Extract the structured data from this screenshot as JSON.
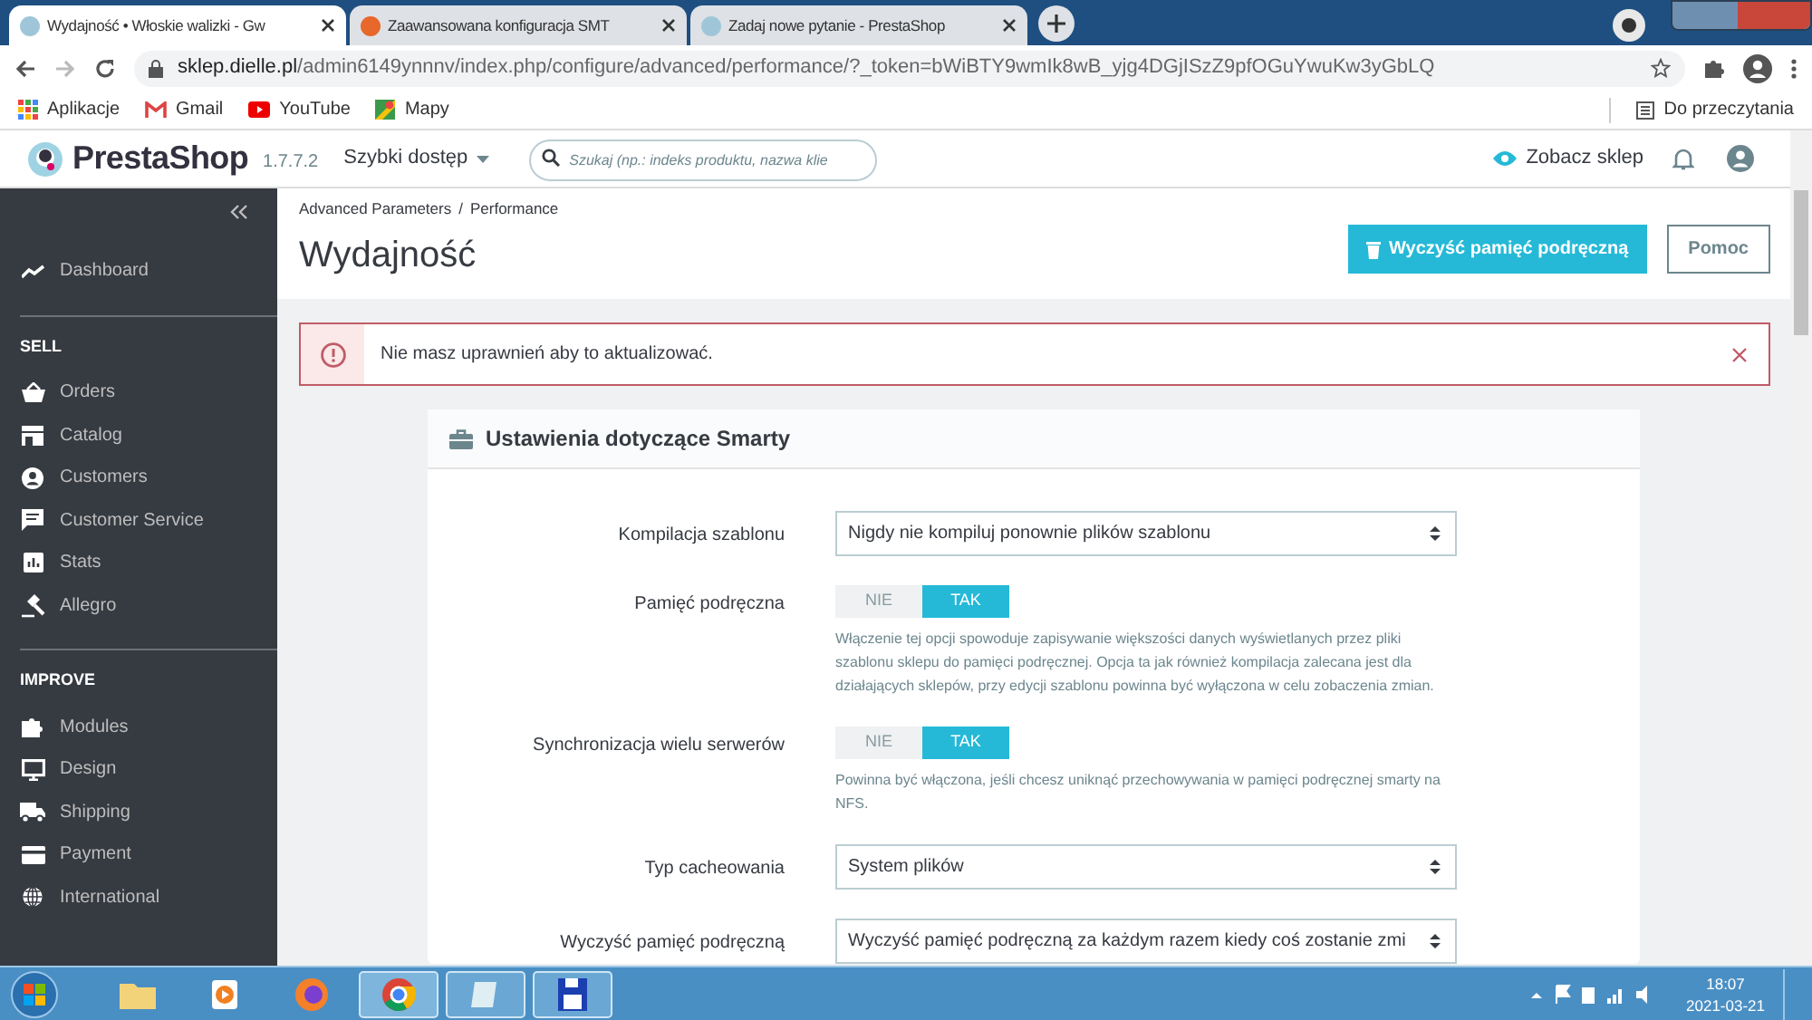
{
  "browser": {
    "tabs": [
      {
        "title": "Wydajność • Włoskie walizki - Gw",
        "selected": true
      },
      {
        "title": "Zaawansowana konfiguracja SMT",
        "selected": false
      },
      {
        "title": "Zadaj nowe pytanie - PrestaShop",
        "selected": false
      }
    ],
    "url": {
      "host": "sklep.dielle.pl",
      "path": "/admin6149ynnnv/index.php/configure/advanced/performance/?_token=bWiBTY9wmIk8wB_yjg4DGjISzZ9pfOGuYwuKw3yGbLQ"
    },
    "bookmarks": [
      {
        "label": "Aplikacje"
      },
      {
        "label": "Gmail"
      },
      {
        "label": "YouTube"
      },
      {
        "label": "Mapy"
      }
    ],
    "reading_list": "Do przeczytania"
  },
  "header": {
    "logo": "PrestaShop",
    "version": "1.7.7.2",
    "quick_access": "Szybki dostęp",
    "search_placeholder": "Szukaj (np.: indeks produktu, nazwa klie",
    "view_shop": "Zobacz sklep"
  },
  "sidebar": {
    "top_item": "Dashboard",
    "sections": [
      {
        "title": "SELL",
        "items": [
          "Orders",
          "Catalog",
          "Customers",
          "Customer Service",
          "Stats",
          "Allegro"
        ]
      },
      {
        "title": "IMPROVE",
        "items": [
          "Modules",
          "Design",
          "Shipping",
          "Payment",
          "International"
        ]
      }
    ]
  },
  "page": {
    "breadcrumb": [
      "Advanced Parameters",
      "Performance"
    ],
    "breadcrumb_separator": "/",
    "title": "Wydajność",
    "buttons": [
      {
        "label": "Wyczyść pamięć podręczną",
        "kind": "primary"
      },
      {
        "label": "Pomoc",
        "kind": "outline"
      }
    ]
  },
  "alert": {
    "text": "Nie masz uprawnień aby to aktualizować."
  },
  "card": {
    "title": "Ustawienia dotyczące Smarty",
    "fields": [
      {
        "kind": "select",
        "label": "Kompilacja szablonu",
        "value": "Nigdy nie kompiluj ponownie plików szablonu"
      },
      {
        "kind": "toggle",
        "label": "Pamięć podręczna",
        "options": [
          {
            "label": "NIE",
            "selected": false
          },
          {
            "label": "TAK",
            "selected": true
          }
        ],
        "help": "Włączenie tej opcji spowoduje zapisywanie większości danych wyświetlanych przez pliki szablonu sklepu do pamięci podręcznej. Opcja ta jak również kompilacja zalecana jest dla działających sklepów, przy edycji szablonu powinna być wyłączona w celu zobaczenia zmian."
      },
      {
        "kind": "toggle",
        "label": "Synchronizacja wielu serwerów",
        "options": [
          {
            "label": "NIE",
            "selected": false
          },
          {
            "label": "TAK",
            "selected": true
          }
        ],
        "help": "Powinna być włączona, jeśli chcesz uniknąć przechowywania w pamięci podręcznej smarty na NFS."
      },
      {
        "kind": "select",
        "label": "Typ cacheowania",
        "value": "System plików"
      },
      {
        "kind": "select",
        "label": "Wyczyść pamięć podręczną",
        "value": "Wyczyść pamięć podręczną za każdym razem kiedy coś zostanie zmi"
      }
    ]
  },
  "taskbar": {
    "time": "18:07",
    "date": "2021-03-21"
  }
}
